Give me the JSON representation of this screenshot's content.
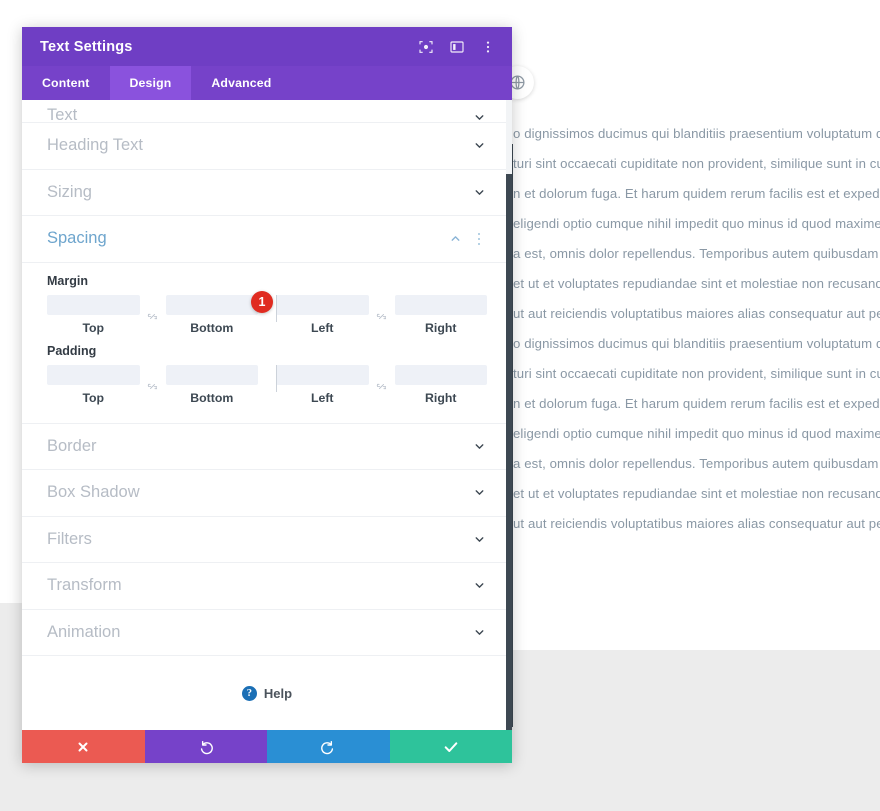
{
  "modal": {
    "title": "Text Settings",
    "header_icons": [
      {
        "name": "focus-target-icon"
      },
      {
        "name": "layout-panel-icon"
      },
      {
        "name": "more-vertical-icon"
      }
    ],
    "tabs": [
      {
        "label": "Content",
        "active": false
      },
      {
        "label": "Design",
        "active": true
      },
      {
        "label": "Advanced",
        "active": false
      }
    ],
    "sections_above": [
      {
        "label": "Text",
        "state": "collapsed"
      },
      {
        "label": "Heading Text",
        "state": "collapsed"
      },
      {
        "label": "Sizing",
        "state": "collapsed"
      }
    ],
    "spacing": {
      "label": "Spacing",
      "state": "expanded",
      "margin": {
        "label": "Margin",
        "fields": [
          {
            "caption": "Top",
            "value": "",
            "placeholder": ""
          },
          {
            "caption": "Bottom",
            "value": "",
            "placeholder": ""
          },
          {
            "caption": "Left",
            "value": "",
            "placeholder": ""
          },
          {
            "caption": "Right",
            "value": "",
            "placeholder": ""
          }
        ],
        "badge": "1"
      },
      "padding": {
        "label": "Padding",
        "fields": [
          {
            "caption": "Top",
            "value": "",
            "placeholder": ""
          },
          {
            "caption": "Bottom",
            "value": "",
            "placeholder": ""
          },
          {
            "caption": "Left",
            "value": "",
            "placeholder": ""
          },
          {
            "caption": "Right",
            "value": "",
            "placeholder": ""
          }
        ]
      }
    },
    "sections_below": [
      {
        "label": "Border",
        "state": "collapsed"
      },
      {
        "label": "Box Shadow",
        "state": "collapsed"
      },
      {
        "label": "Filters",
        "state": "collapsed"
      },
      {
        "label": "Transform",
        "state": "collapsed"
      },
      {
        "label": "Animation",
        "state": "collapsed"
      }
    ],
    "help": {
      "label": "Help",
      "icon": "question-mark-icon"
    },
    "footer_buttons": [
      {
        "name": "cancel-button",
        "icon": "close-x-icon",
        "color": "#eb5a52"
      },
      {
        "name": "undo-button",
        "icon": "undo-arrow-icon",
        "color": "#7642c9"
      },
      {
        "name": "redo-button",
        "icon": "redo-arrow-icon",
        "color": "#2a8fd4"
      },
      {
        "name": "save-button",
        "icon": "checkmark-icon",
        "color": "#2ec39b"
      }
    ]
  },
  "background": {
    "globe_icon": "globe-icon",
    "paragraph_lines": [
      "o dignissimos ducimus qui blanditiis praesentium voluptatum deleniti atqu",
      "turi sint occaecati cupiditate non provident, similique sunt in culpa qui off",
      "n et dolorum fuga. Et harum quidem rerum facilis est et expedita distinctio",
      "eligendi optio cumque nihil impedit quo minus id quod maxime placeat fa",
      "a est, omnis dolor repellendus. Temporibus autem quibusdam et aut offici",
      "et ut et voluptates repudiandae sint et molestiae non recusandae. Itaque",
      "ut aut reiciendis voluptatibus maiores alias consequatur aut perferendis"
    ]
  },
  "colors": {
    "header_purple": "#6f3ec4",
    "tabs_purple": "#7642c9",
    "tab_active_purple": "#8a52dd",
    "badge_red": "#e02b20",
    "accent_blue": "#6ea5cd",
    "scrollbar_dark": "#3d4852",
    "page_gray": "#ececec"
  }
}
